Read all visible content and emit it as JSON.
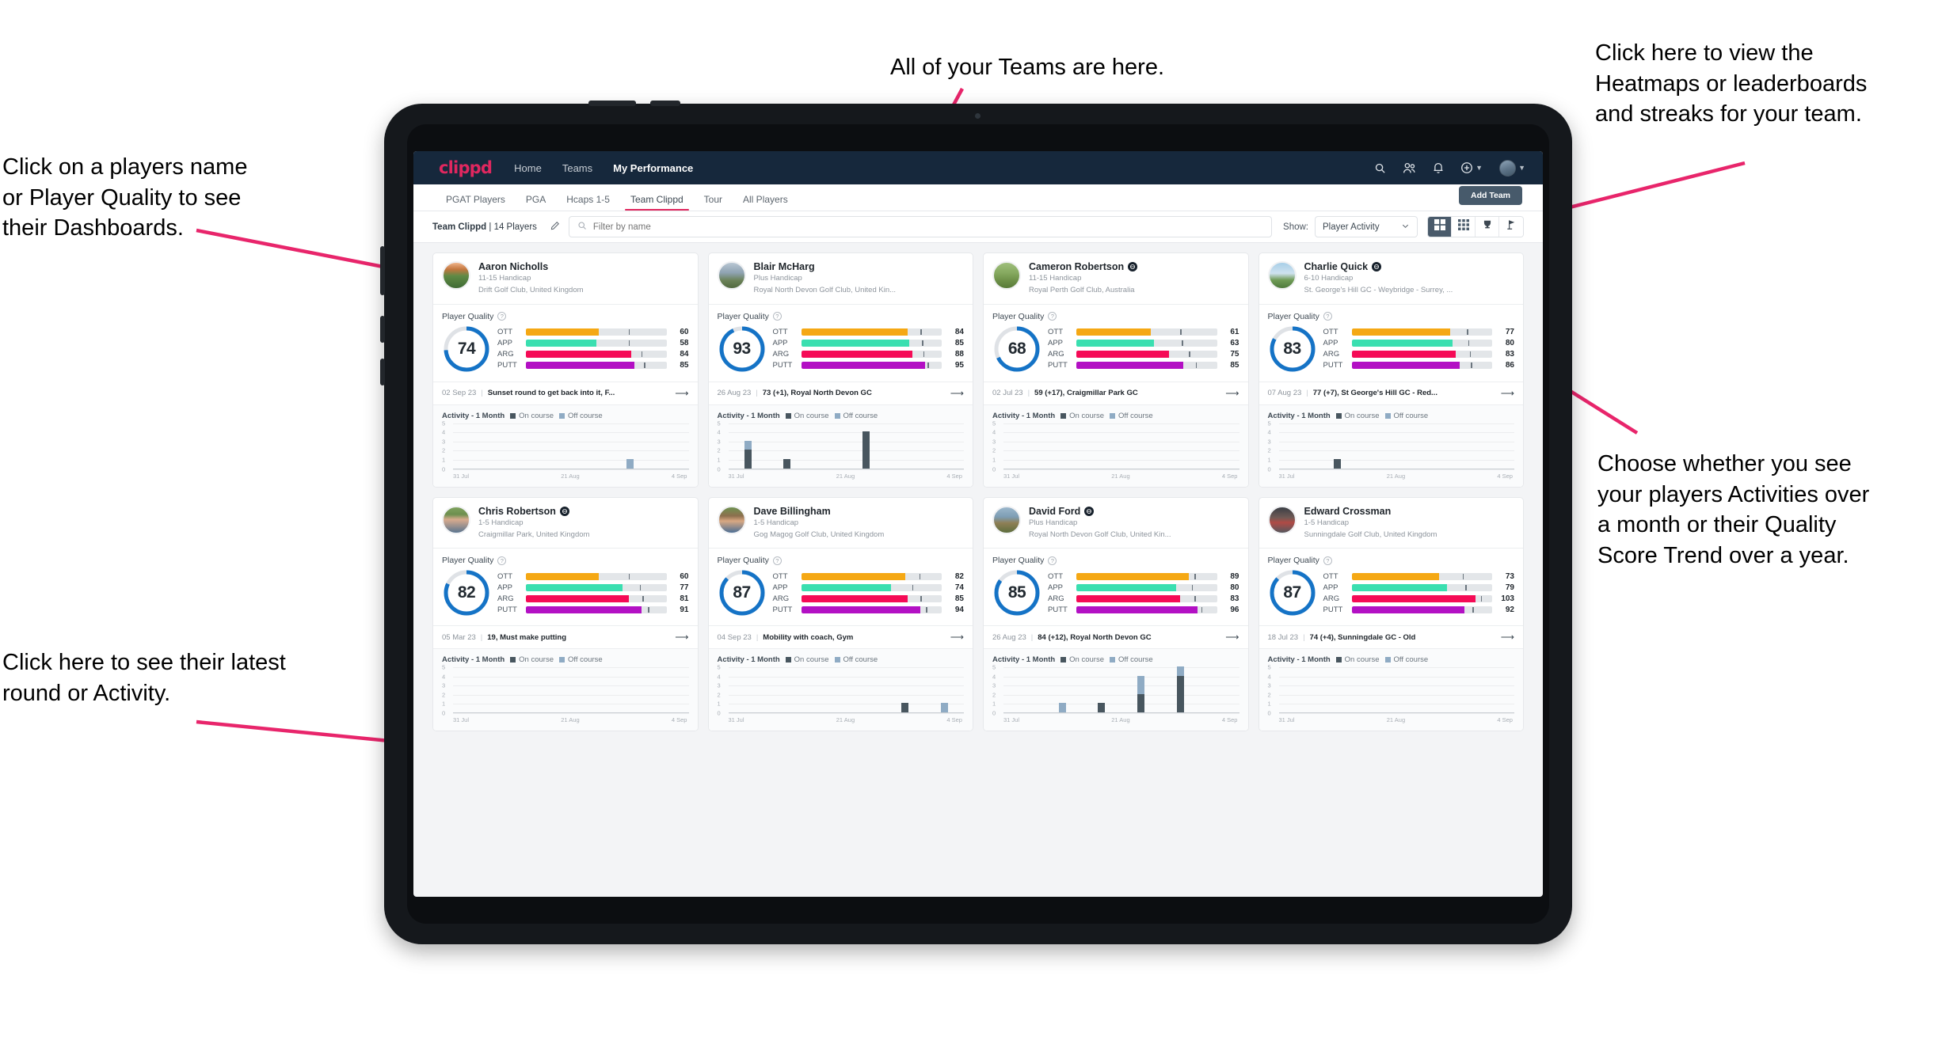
{
  "annotations": [
    {
      "id": "teams",
      "text": "All of your Teams are here."
    },
    {
      "id": "heatmaps",
      "text": "Click here to view the\nHeatmaps or leaderboards\nand streaks for your team."
    },
    {
      "id": "players-name",
      "text": "Click on a players name\nor Player Quality to see\ntheir Dashboards."
    },
    {
      "id": "activity-quality",
      "text": "Choose whether you see\nyour players Activities over\na month or their Quality\nScore Trend over a year."
    },
    {
      "id": "latest-round",
      "text": "Click here to see their latest\nround or Activity."
    }
  ],
  "app": {
    "brand": "clippd",
    "nav": [
      {
        "label": "Home",
        "active": false
      },
      {
        "label": "Teams",
        "active": false
      },
      {
        "label": "My Performance",
        "active": true
      }
    ],
    "nav_icons": [
      "search-icon",
      "people-icon",
      "bell-icon",
      "plus-circle-icon",
      "avatar"
    ],
    "tabs": [
      {
        "label": "PGAT Players",
        "active": false
      },
      {
        "label": "PGA",
        "active": false
      },
      {
        "label": "Hcaps 1-5",
        "active": false
      },
      {
        "label": "Team Clippd",
        "active": true
      },
      {
        "label": "Tour",
        "active": false
      },
      {
        "label": "All Players",
        "active": false
      }
    ],
    "add_team_label": "Add Team",
    "toolbar": {
      "team_name": "Team Clippd",
      "team_separator": "|",
      "team_count": "14 Players",
      "edit_icon": "pencil-icon",
      "search_placeholder": "Filter by name",
      "search_value": "",
      "show_label": "Show:",
      "show_value": "Player Activity",
      "show_options": [
        "Player Activity",
        "Quality Score Trend"
      ],
      "view_buttons": [
        {
          "icon": "grid-large-icon",
          "active": true
        },
        {
          "icon": "grid-small-icon",
          "active": false
        },
        {
          "icon": "trophy-icon",
          "active": false
        },
        {
          "icon": "flag-icon",
          "active": false
        }
      ]
    },
    "card_labels": {
      "player_quality": "Player Quality",
      "activity_title": "Activity - 1 Month",
      "legend_on": "On course",
      "legend_off": "Off course",
      "metrics": [
        "OTT",
        "APP",
        "ARG",
        "PUTT"
      ]
    },
    "colors": {
      "accent": "#e0275f",
      "navbar": "#16283c",
      "ott": "#f5a814",
      "app": "#3adfb0",
      "arg": "#f50b56",
      "putt": "#b310c4",
      "donut": "#1573c6",
      "on_course": "#48565f",
      "off_course": "#8fabc4"
    },
    "chart_axis": {
      "y_ticks": [
        "5",
        "4",
        "3",
        "2",
        "1",
        "0"
      ],
      "x_ticks": [
        "31 Jul",
        "21 Aug",
        "4 Sep"
      ],
      "ymax": 5
    },
    "players": [
      {
        "name": "Aaron Nicholls",
        "verified": false,
        "handicap": "11-15 Handicap",
        "club": "Drift Golf Club, United Kingdom",
        "quality": 74,
        "metrics": [
          {
            "label": "OTT",
            "value": 60,
            "fill": 52,
            "tick": 73
          },
          {
            "label": "APP",
            "value": 58,
            "fill": 50,
            "tick": 73
          },
          {
            "label": "ARG",
            "value": 84,
            "fill": 75,
            "tick": 82
          },
          {
            "label": "PUTT",
            "value": 85,
            "fill": 77,
            "tick": 84
          }
        ],
        "latest_date": "02 Sep 23",
        "latest_text": "Sunset round to get back into it, F...",
        "activity": [
          {
            "on": 0,
            "off": 0
          },
          {
            "on": 0,
            "off": 0
          },
          {
            "on": 0,
            "off": 0
          },
          {
            "on": 0,
            "off": 0
          },
          {
            "on": 0,
            "off": 1
          },
          {
            "on": 0,
            "off": 0
          }
        ]
      },
      {
        "name": "Blair McHarg",
        "verified": false,
        "handicap": "Plus Handicap",
        "club": "Royal North Devon Golf Club, United Kin...",
        "quality": 93,
        "metrics": [
          {
            "label": "OTT",
            "value": 84,
            "fill": 76,
            "tick": 85
          },
          {
            "label": "APP",
            "value": 85,
            "fill": 77,
            "tick": 86
          },
          {
            "label": "ARG",
            "value": 88,
            "fill": 79,
            "tick": 87
          },
          {
            "label": "PUTT",
            "value": 95,
            "fill": 88,
            "tick": 90
          }
        ],
        "latest_date": "26 Aug 23",
        "latest_text": "73 (+1), Royal North Devon GC",
        "activity": [
          {
            "on": 2,
            "off": 1
          },
          {
            "on": 1,
            "off": 0
          },
          {
            "on": 0,
            "off": 0
          },
          {
            "on": 4,
            "off": 0
          },
          {
            "on": 0,
            "off": 0
          },
          {
            "on": 0,
            "off": 0
          }
        ]
      },
      {
        "name": "Cameron Robertson",
        "verified": true,
        "handicap": "11-15 Handicap",
        "club": "Royal Perth Golf Club, Australia",
        "quality": 68,
        "metrics": [
          {
            "label": "OTT",
            "value": 61,
            "fill": 53,
            "tick": 74
          },
          {
            "label": "APP",
            "value": 63,
            "fill": 55,
            "tick": 75
          },
          {
            "label": "ARG",
            "value": 75,
            "fill": 66,
            "tick": 80
          },
          {
            "label": "PUTT",
            "value": 85,
            "fill": 76,
            "tick": 85
          }
        ],
        "latest_date": "02 Jul 23",
        "latest_text": "59 (+17), Craigmillar Park GC",
        "activity": [
          {
            "on": 0,
            "off": 0
          },
          {
            "on": 0,
            "off": 0
          },
          {
            "on": 0,
            "off": 0
          },
          {
            "on": 0,
            "off": 0
          },
          {
            "on": 0,
            "off": 0
          },
          {
            "on": 0,
            "off": 0
          }
        ]
      },
      {
        "name": "Charlie Quick",
        "verified": true,
        "handicap": "6-10 Handicap",
        "club": "St. George's Hill GC - Weybridge - Surrey, ...",
        "quality": 83,
        "metrics": [
          {
            "label": "OTT",
            "value": 77,
            "fill": 70,
            "tick": 82
          },
          {
            "label": "APP",
            "value": 80,
            "fill": 72,
            "tick": 83
          },
          {
            "label": "ARG",
            "value": 83,
            "fill": 74,
            "tick": 84
          },
          {
            "label": "PUTT",
            "value": 86,
            "fill": 77,
            "tick": 85
          }
        ],
        "latest_date": "07 Aug 23",
        "latest_text": "77 (+7), St George's Hill GC - Red...",
        "activity": [
          {
            "on": 0,
            "off": 0
          },
          {
            "on": 1,
            "off": 0
          },
          {
            "on": 0,
            "off": 0
          },
          {
            "on": 0,
            "off": 0
          },
          {
            "on": 0,
            "off": 0
          },
          {
            "on": 0,
            "off": 0
          }
        ]
      },
      {
        "name": "Chris Robertson",
        "verified": true,
        "handicap": "1-5 Handicap",
        "club": "Craigmillar Park, United Kingdom",
        "quality": 82,
        "metrics": [
          {
            "label": "OTT",
            "value": 60,
            "fill": 52,
            "tick": 73
          },
          {
            "label": "APP",
            "value": 77,
            "fill": 69,
            "tick": 81
          },
          {
            "label": "ARG",
            "value": 81,
            "fill": 73,
            "tick": 83
          },
          {
            "label": "PUTT",
            "value": 91,
            "fill": 82,
            "tick": 87
          }
        ],
        "latest_date": "05 Mar 23",
        "latest_text": "19, Must make putting",
        "activity": [
          {
            "on": 0,
            "off": 0
          },
          {
            "on": 0,
            "off": 0
          },
          {
            "on": 0,
            "off": 0
          },
          {
            "on": 0,
            "off": 0
          },
          {
            "on": 0,
            "off": 0
          },
          {
            "on": 0,
            "off": 0
          }
        ]
      },
      {
        "name": "Dave Billingham",
        "verified": false,
        "handicap": "1-5 Handicap",
        "club": "Gog Magog Golf Club, United Kingdom",
        "quality": 87,
        "metrics": [
          {
            "label": "OTT",
            "value": 82,
            "fill": 74,
            "tick": 84
          },
          {
            "label": "APP",
            "value": 74,
            "fill": 64,
            "tick": 79
          },
          {
            "label": "ARG",
            "value": 85,
            "fill": 76,
            "tick": 85
          },
          {
            "label": "PUTT",
            "value": 94,
            "fill": 85,
            "tick": 89
          }
        ],
        "latest_date": "04 Sep 23",
        "latest_text": "Mobility with coach, Gym",
        "activity": [
          {
            "on": 0,
            "off": 0
          },
          {
            "on": 0,
            "off": 0
          },
          {
            "on": 0,
            "off": 0
          },
          {
            "on": 0,
            "off": 0
          },
          {
            "on": 1,
            "off": 0
          },
          {
            "on": 0,
            "off": 1
          }
        ]
      },
      {
        "name": "David Ford",
        "verified": true,
        "handicap": "Plus Handicap",
        "club": "Royal North Devon Golf Club, United Kin...",
        "quality": 85,
        "metrics": [
          {
            "label": "OTT",
            "value": 89,
            "fill": 80,
            "tick": 84
          },
          {
            "label": "APP",
            "value": 80,
            "fill": 71,
            "tick": 82
          },
          {
            "label": "ARG",
            "value": 83,
            "fill": 74,
            "tick": 84
          },
          {
            "label": "PUTT",
            "value": 96,
            "fill": 86,
            "tick": 89
          }
        ],
        "latest_date": "26 Aug 23",
        "latest_text": "84 (+12), Royal North Devon GC",
        "activity": [
          {
            "on": 0,
            "off": 0
          },
          {
            "on": 0,
            "off": 1
          },
          {
            "on": 1,
            "off": 0
          },
          {
            "on": 2,
            "off": 2
          },
          {
            "on": 4,
            "off": 1
          },
          {
            "on": 0,
            "off": 0
          }
        ]
      },
      {
        "name": "Edward Crossman",
        "verified": false,
        "handicap": "1-5 Handicap",
        "club": "Sunningdale Golf Club, United Kingdom",
        "quality": 87,
        "metrics": [
          {
            "label": "OTT",
            "value": 73,
            "fill": 62,
            "tick": 79
          },
          {
            "label": "APP",
            "value": 79,
            "fill": 68,
            "tick": 81
          },
          {
            "label": "ARG",
            "value": 103,
            "fill": 88,
            "tick": 92
          },
          {
            "label": "PUTT",
            "value": 92,
            "fill": 80,
            "tick": 86
          }
        ],
        "latest_date": "18 Jul 23",
        "latest_text": "74 (+4), Sunningdale GC - Old",
        "activity": [
          {
            "on": 0,
            "off": 0
          },
          {
            "on": 0,
            "off": 0
          },
          {
            "on": 0,
            "off": 0
          },
          {
            "on": 0,
            "off": 0
          },
          {
            "on": 0,
            "off": 0
          },
          {
            "on": 0,
            "off": 0
          }
        ]
      }
    ]
  }
}
